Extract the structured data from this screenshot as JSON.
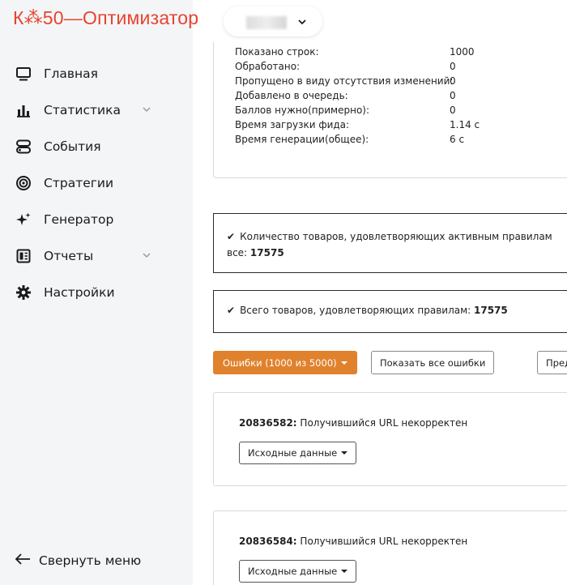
{
  "app": {
    "logo_text": "К⁂50—Оптимизатор",
    "brand_color": "#e8432f"
  },
  "sidebar": {
    "items": [
      {
        "label": "Главная",
        "icon": "monitor-icon",
        "has_chevron": false
      },
      {
        "label": "Статистика",
        "icon": "bar-chart-icon",
        "has_chevron": true
      },
      {
        "label": "События",
        "icon": "toggle-icon",
        "has_chevron": false
      },
      {
        "label": "Стратегии",
        "icon": "target-icon",
        "has_chevron": false
      },
      {
        "label": "Генератор",
        "icon": "sparkles-icon",
        "has_chevron": false
      },
      {
        "label": "Отчеты",
        "icon": "report-icon",
        "has_chevron": true
      },
      {
        "label": "Настройки",
        "icon": "gear-icon",
        "has_chevron": false
      }
    ],
    "collapse_label": "Свернуть меню"
  },
  "stats": {
    "rows": [
      {
        "label": "Показано строк:",
        "value": "1000"
      },
      {
        "label": "Обработано:",
        "value": "0"
      },
      {
        "label": "Пропущено в виду отсутствия изменений:",
        "value": "0"
      },
      {
        "label": "Добавлено в очередь:",
        "value": "0"
      },
      {
        "label": "Баллов нужно(примерно):",
        "value": "0"
      },
      {
        "label": "Время загрузки фида:",
        "value": "1.14 с"
      },
      {
        "label": "Время генерации(общее):",
        "value": "6 с"
      }
    ]
  },
  "alerts": {
    "active_text": "Количество товаров, удовлетворяющих активным правилам",
    "active_all_prefix": "все: ",
    "active_count": "17575",
    "total_text": "Всего товаров, удовлетворяющих правилам: ",
    "total_count": "17575"
  },
  "toolbar": {
    "errors_label": "Ошибки (1000 из 5000)",
    "show_all_label": "Показать все ошибки",
    "next_label": "Пред"
  },
  "errors": [
    {
      "id": "20836582:",
      "message": " Получившийся URL некорректен",
      "button": "Исходные данные"
    },
    {
      "id": "20836584:",
      "message": " Получившийся URL некорректен",
      "button": "Исходные данные"
    }
  ]
}
